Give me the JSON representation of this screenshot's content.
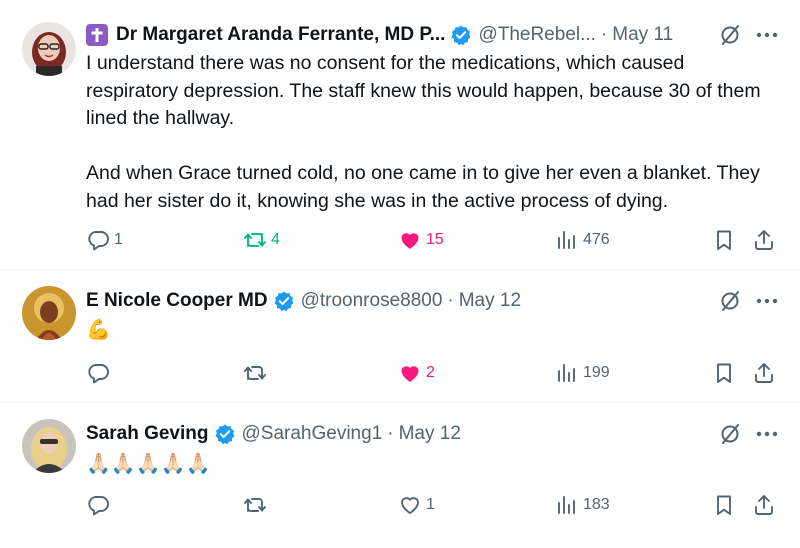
{
  "tweets": [
    {
      "author_name": "Dr Margaret Aranda Ferrante, MD P...",
      "handle": "@TheRebel...",
      "date": "May 11",
      "separator": "·",
      "paragraphs": [
        "I understand there was no consent for the medications, which caused respiratory depression. The staff knew this would happen, because 30 of them lined the hallway.",
        "And when Grace turned cold, no one came in to give her even a blanket. They had her sister do it, knowing she was in the active process of dying."
      ],
      "replies": "1",
      "retweets": "4",
      "likes": "15",
      "views": "476"
    },
    {
      "author_name": "E Nicole Cooper MD",
      "handle": "@troonrose8800",
      "date": "May 12",
      "separator": "·",
      "text": "💪",
      "replies": "",
      "retweets": "",
      "likes": "2",
      "views": "199"
    },
    {
      "author_name": "Sarah Geving",
      "handle": "@SarahGeving1",
      "date": "May 12",
      "separator": "·",
      "text": "🙏🏻🙏🏻🙏🏻🙏🏻🙏🏻",
      "replies": "",
      "retweets": "",
      "likes": "1",
      "views": "183"
    }
  ],
  "colors": {
    "verified_blue": "#1d9bf0",
    "retweet_green": "#00ba7c",
    "like_pink": "#f91880",
    "secondary_text": "#536471",
    "cross_badge_purple": "#8e5bc6"
  },
  "icons": {
    "reply": "speech-bubble-icon",
    "retweet": "retweet-arrows-icon",
    "like": "heart-icon",
    "views": "bar-chart-icon",
    "bookmark": "bookmark-icon",
    "share": "share-upload-icon",
    "grok": "grok-slash-circle-icon",
    "more": "more-dots-icon",
    "verified": "verified-badge-icon",
    "cross": "latin-cross-icon"
  }
}
